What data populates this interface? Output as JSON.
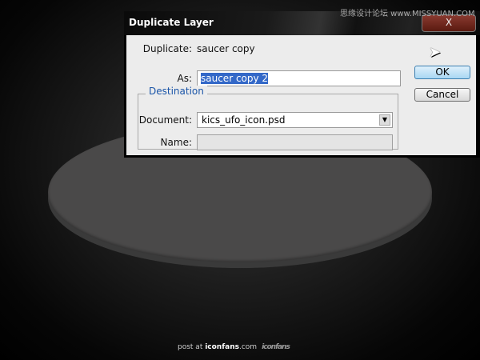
{
  "dialog": {
    "title": "Duplicate Layer",
    "close": "X",
    "duplicate_label": "Duplicate:",
    "duplicate_value": "saucer copy",
    "as_label": "As:",
    "as_value": "saucer copy 2",
    "ok": "OK",
    "cancel": "Cancel",
    "destination_title": "Destination",
    "document_label": "Document:",
    "document_value": "kics_ufo_icon.psd",
    "name_label": "Name:",
    "name_value": ""
  },
  "watermark": "思缘设计论坛 www.MISSYUAN.COM",
  "footer": {
    "prefix": "post at ",
    "site": "iconfans",
    "suffix": ".com",
    "logo": "iconfans"
  }
}
